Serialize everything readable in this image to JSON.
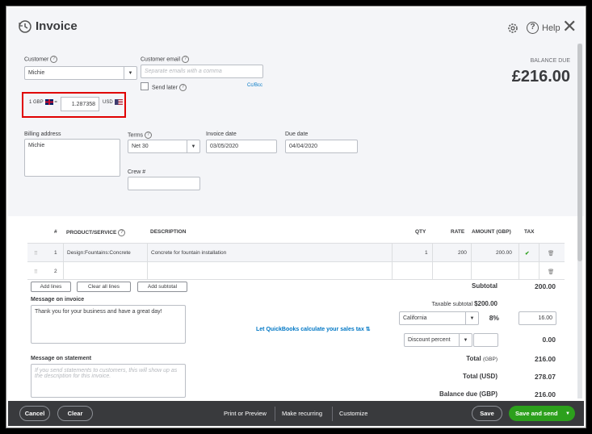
{
  "window": {
    "title": "Invoice",
    "help_label": "Help"
  },
  "customer": {
    "label": "Customer",
    "value": "Michie",
    "email_label": "Customer email",
    "email_placeholder": "Separate emails with a comma",
    "send_later_label": "Send later",
    "cc_bcc_link": "Cc/Bcc"
  },
  "balance": {
    "label": "BALANCE DUE",
    "amount": "£216.00"
  },
  "exchange": {
    "base": "1 GBP",
    "rate": "1.287358",
    "target": "USD"
  },
  "billing": {
    "address_label": "Billing address",
    "address_value": "Michie",
    "terms_label": "Terms",
    "terms_value": "Net 30",
    "invoice_date_label": "Invoice date",
    "invoice_date_value": "03/05/2020",
    "due_date_label": "Due date",
    "due_date_value": "04/04/2020",
    "crew_label": "Crew #"
  },
  "table": {
    "headers": {
      "num": "#",
      "product": "PRODUCT/SERVICE",
      "description": "DESCRIPTION",
      "qty": "QTY",
      "rate": "RATE",
      "amount": "AMOUNT (GBP)",
      "tax": "TAX"
    },
    "rows": [
      {
        "num": "1",
        "product": "Design:Fountains:Concrete",
        "description": "Concrete for fountain installation",
        "qty": "1",
        "rate": "200",
        "amount": "200.00",
        "tax": "✔"
      },
      {
        "num": "2",
        "product": "",
        "description": "",
        "qty": "",
        "rate": "",
        "amount": "",
        "tax": ""
      }
    ],
    "add_lines": "Add lines",
    "clear_all_lines": "Clear all lines",
    "add_subtotal": "Add subtotal"
  },
  "messages": {
    "invoice_label": "Message on invoice",
    "invoice_value": "Thank you for your business and have a great day!",
    "statement_label": "Message on statement",
    "statement_placeholder": "If you send statements to customers, this will show up as the description for this invoice."
  },
  "totals": {
    "subtotal_label": "Subtotal",
    "subtotal_value": "200.00",
    "taxable_label": "Taxable subtotal",
    "taxable_value": "$200.00",
    "calc_tax_link": "Let QuickBooks calculate your sales tax",
    "tax_region": "California",
    "tax_rate": "8%",
    "tax_amount": "16.00",
    "discount_type": "Discount percent",
    "discount_value": "0.00",
    "total_gbp_label": "Total",
    "total_gbp_unit": "(GBP)",
    "total_gbp_value": "216.00",
    "total_usd_label": "Total (USD)",
    "total_usd_value": "278.07",
    "balance_due_label": "Balance due (GBP)",
    "balance_due_value": "216.00"
  },
  "footer": {
    "cancel": "Cancel",
    "clear": "Clear",
    "print_preview": "Print or Preview",
    "make_recurring": "Make recurring",
    "customize": "Customize",
    "save": "Save",
    "save_and_send": "Save and send"
  }
}
